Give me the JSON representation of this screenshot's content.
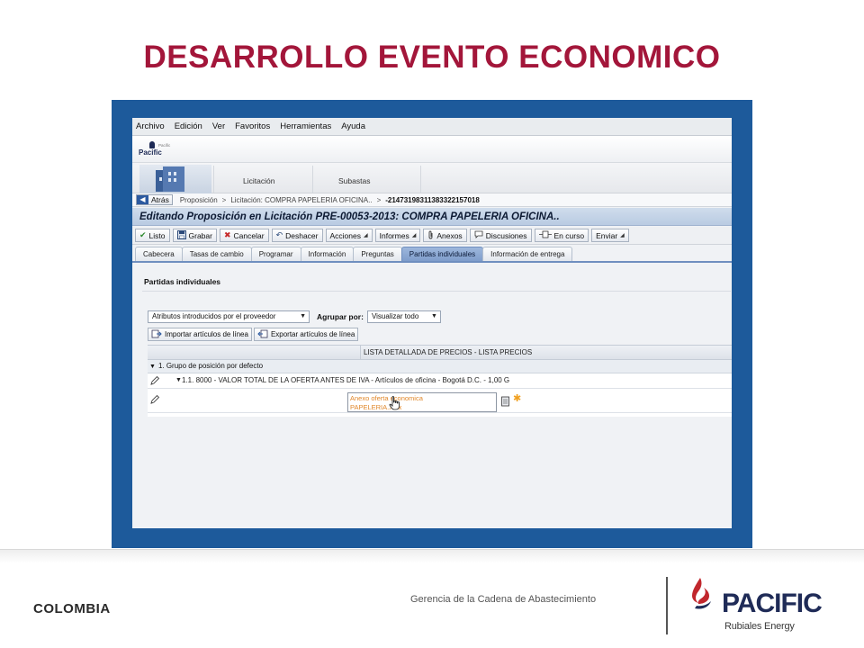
{
  "slide": {
    "title": "DESARROLLO EVENTO ECONOMICO",
    "footer_country": "COLOMBIA",
    "footer_text": "Gerencia de la Cadena de Abastecimiento",
    "logo": {
      "name": "PACIFIC",
      "subtitle": "Rubiales Energy",
      "mark_icon": "pacific-drop-logo-icon",
      "mark_colors": [
        "#c1272d",
        "#1f2b57"
      ]
    }
  },
  "colors": {
    "title": "#a3163a",
    "frame": "#1d5a9b",
    "header_band": "#b9cbe2",
    "active_tab": "#7f9dcb",
    "attachment_link": "#e0872a"
  },
  "app": {
    "menu": [
      "Archivo",
      "Edición",
      "Ver",
      "Favoritos",
      "Herramientas",
      "Ayuda"
    ],
    "mini_logo": {
      "text": "Pacific",
      "small": "Pacific"
    },
    "main_tabs": [
      "Licitación",
      "Subastas"
    ],
    "breadcrumb": {
      "back_label": "Atrás",
      "items": [
        "Proposición",
        "Licitación: COMPRA PAPELERIA OFICINA.."
      ],
      "current": "-2147319831138332215701​8"
    },
    "page_header": "Editando Proposición en Licitación PRE-00053-2013: COMPRA PAPELERIA OFICINA..",
    "toolbar": [
      {
        "label": "Listo",
        "icon": "check-icon",
        "glyph": "✔"
      },
      {
        "label": "Grabar",
        "icon": "save-icon",
        "glyph": "💾"
      },
      {
        "label": "Cancelar",
        "icon": "cancel-icon",
        "glyph": "✖"
      },
      {
        "label": "Deshacer",
        "icon": "undo-icon",
        "glyph": "↶"
      },
      {
        "label": "Acciones",
        "icon": "",
        "glyph": "",
        "menu": true
      },
      {
        "label": "Informes",
        "icon": "",
        "glyph": "",
        "menu": true
      },
      {
        "label": "Anexos",
        "icon": "paperclip-icon",
        "glyph": "🖇"
      },
      {
        "label": "Discusiones",
        "icon": "discussion-icon",
        "glyph": "💬"
      },
      {
        "label": "En curso",
        "icon": "in-progress-icon",
        "glyph": "⇆"
      },
      {
        "label": "Enviar",
        "icon": "",
        "glyph": "",
        "menu": true
      }
    ],
    "sub_tabs": [
      {
        "label": "Cabecera",
        "active": false
      },
      {
        "label": "Tasas de cambio",
        "active": false
      },
      {
        "label": "Programar",
        "active": false
      },
      {
        "label": "Información",
        "active": false
      },
      {
        "label": "Preguntas",
        "active": false
      },
      {
        "label": "Partidas individuales",
        "active": true
      },
      {
        "label": "Información de entrega",
        "active": false
      }
    ],
    "section_title": "Partidas individuales",
    "filter": {
      "attributes_select": "Atributos introducidos por el proveedor",
      "group_label": "Agrupar por:",
      "view_select": "Visualizar todo"
    },
    "actions": [
      {
        "label": "Importar artículos de línea",
        "icon": "import-icon"
      },
      {
        "label": "Exportar artículos de línea",
        "icon": "export-icon"
      }
    ],
    "grid": {
      "header": "LISTA DETALLADA DE PRECIOS - LISTA PRECIOS",
      "group_row": "1. Grupo de posición por defecto",
      "item_row": "1.1. 8000 - VALOR TOTAL DE LA OFERTA ANTES DE IVA - Artículos de oficina - Bogotá D.C. - 1,00 G",
      "attachment_lines": [
        "Anexo oferta economica",
        "PAPELERIA.Xlsx"
      ]
    }
  }
}
